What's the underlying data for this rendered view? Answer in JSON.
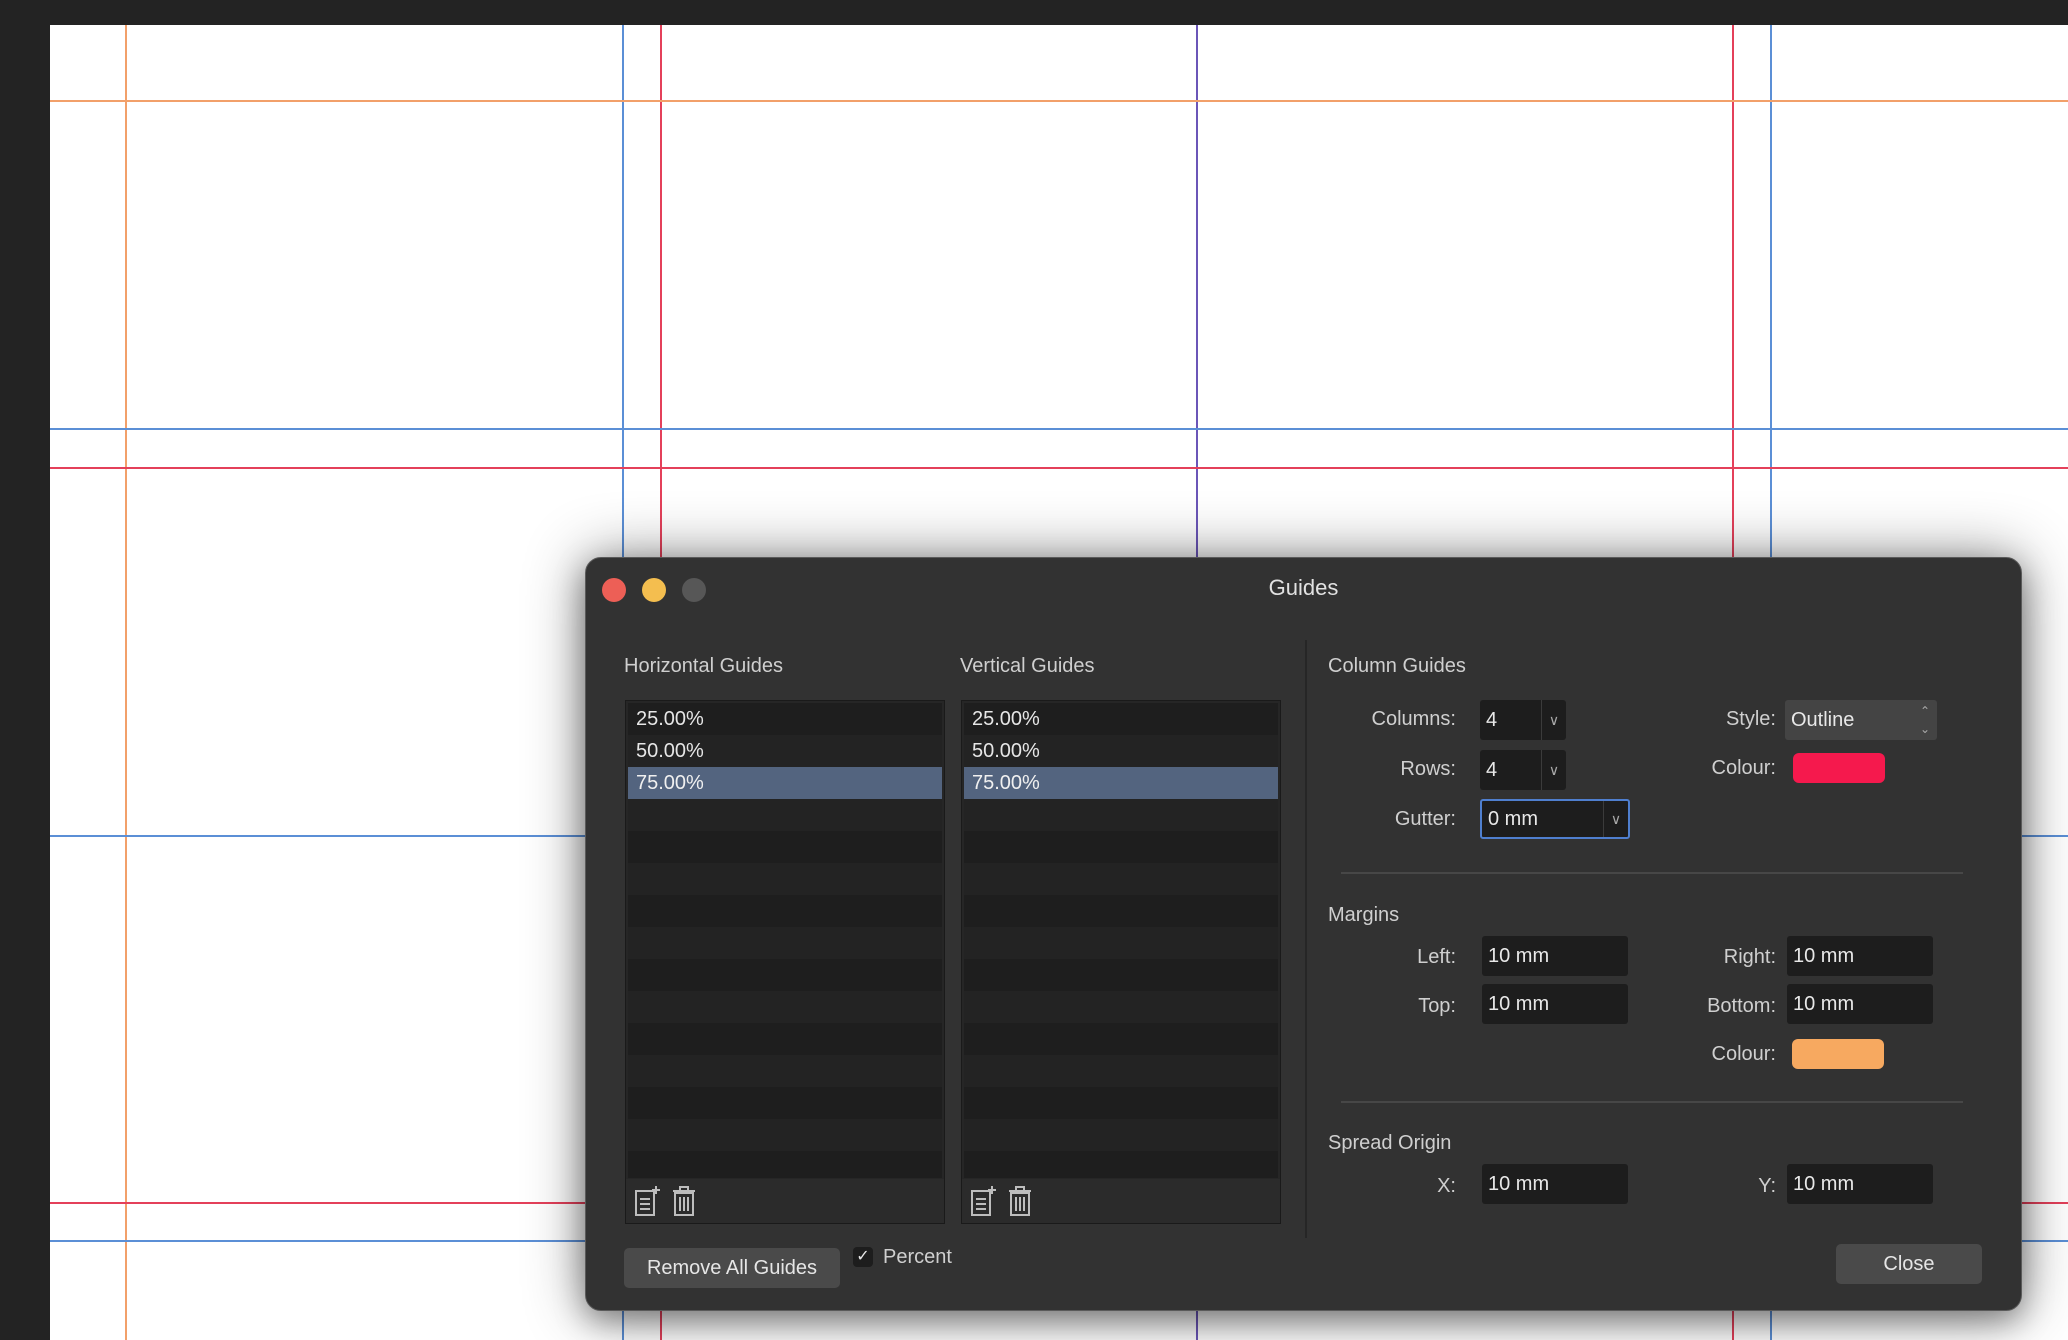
{
  "dialog": {
    "title": "Guides"
  },
  "horizontal_guides": {
    "label": "Horizontal Guides",
    "items": [
      "25.00%",
      "50.00%",
      "75.00%"
    ],
    "selected": "75.00%"
  },
  "vertical_guides": {
    "label": "Vertical Guides",
    "items": [
      "25.00%",
      "50.00%",
      "75.00%"
    ],
    "selected": "75.00%"
  },
  "column_guides": {
    "label": "Column Guides",
    "columns_label": "Columns:",
    "columns_value": "4",
    "rows_label": "Rows:",
    "rows_value": "4",
    "gutter_label": "Gutter:",
    "gutter_value": "0 mm",
    "style_label": "Style:",
    "style_value": "Outline",
    "colour_label": "Colour:",
    "colour": "#f5194d"
  },
  "margins": {
    "label": "Margins",
    "left_label": "Left:",
    "left_value": "10 mm",
    "right_label": "Right:",
    "right_value": "10 mm",
    "top_label": "Top:",
    "top_value": "10 mm",
    "bottom_label": "Bottom:",
    "bottom_value": "10 mm",
    "colour_label": "Colour:",
    "colour": "#f7a960"
  },
  "spread_origin": {
    "label": "Spread Origin",
    "x_label": "X:",
    "x_value": "10 mm",
    "y_label": "Y:",
    "y_value": "10 mm"
  },
  "footer": {
    "remove_all_label": "Remove All Guides",
    "percent_label": "Percent",
    "percent_checked": true,
    "close_label": "Close"
  },
  "guide_colors": {
    "guide": "#5b8fd6",
    "column": "#e4405a",
    "margin": "#f2a06a"
  },
  "icons": [
    "add-guide-icon",
    "trash-icon",
    "chevron-down-icon",
    "stepper-icon",
    "checkmark-icon"
  ]
}
